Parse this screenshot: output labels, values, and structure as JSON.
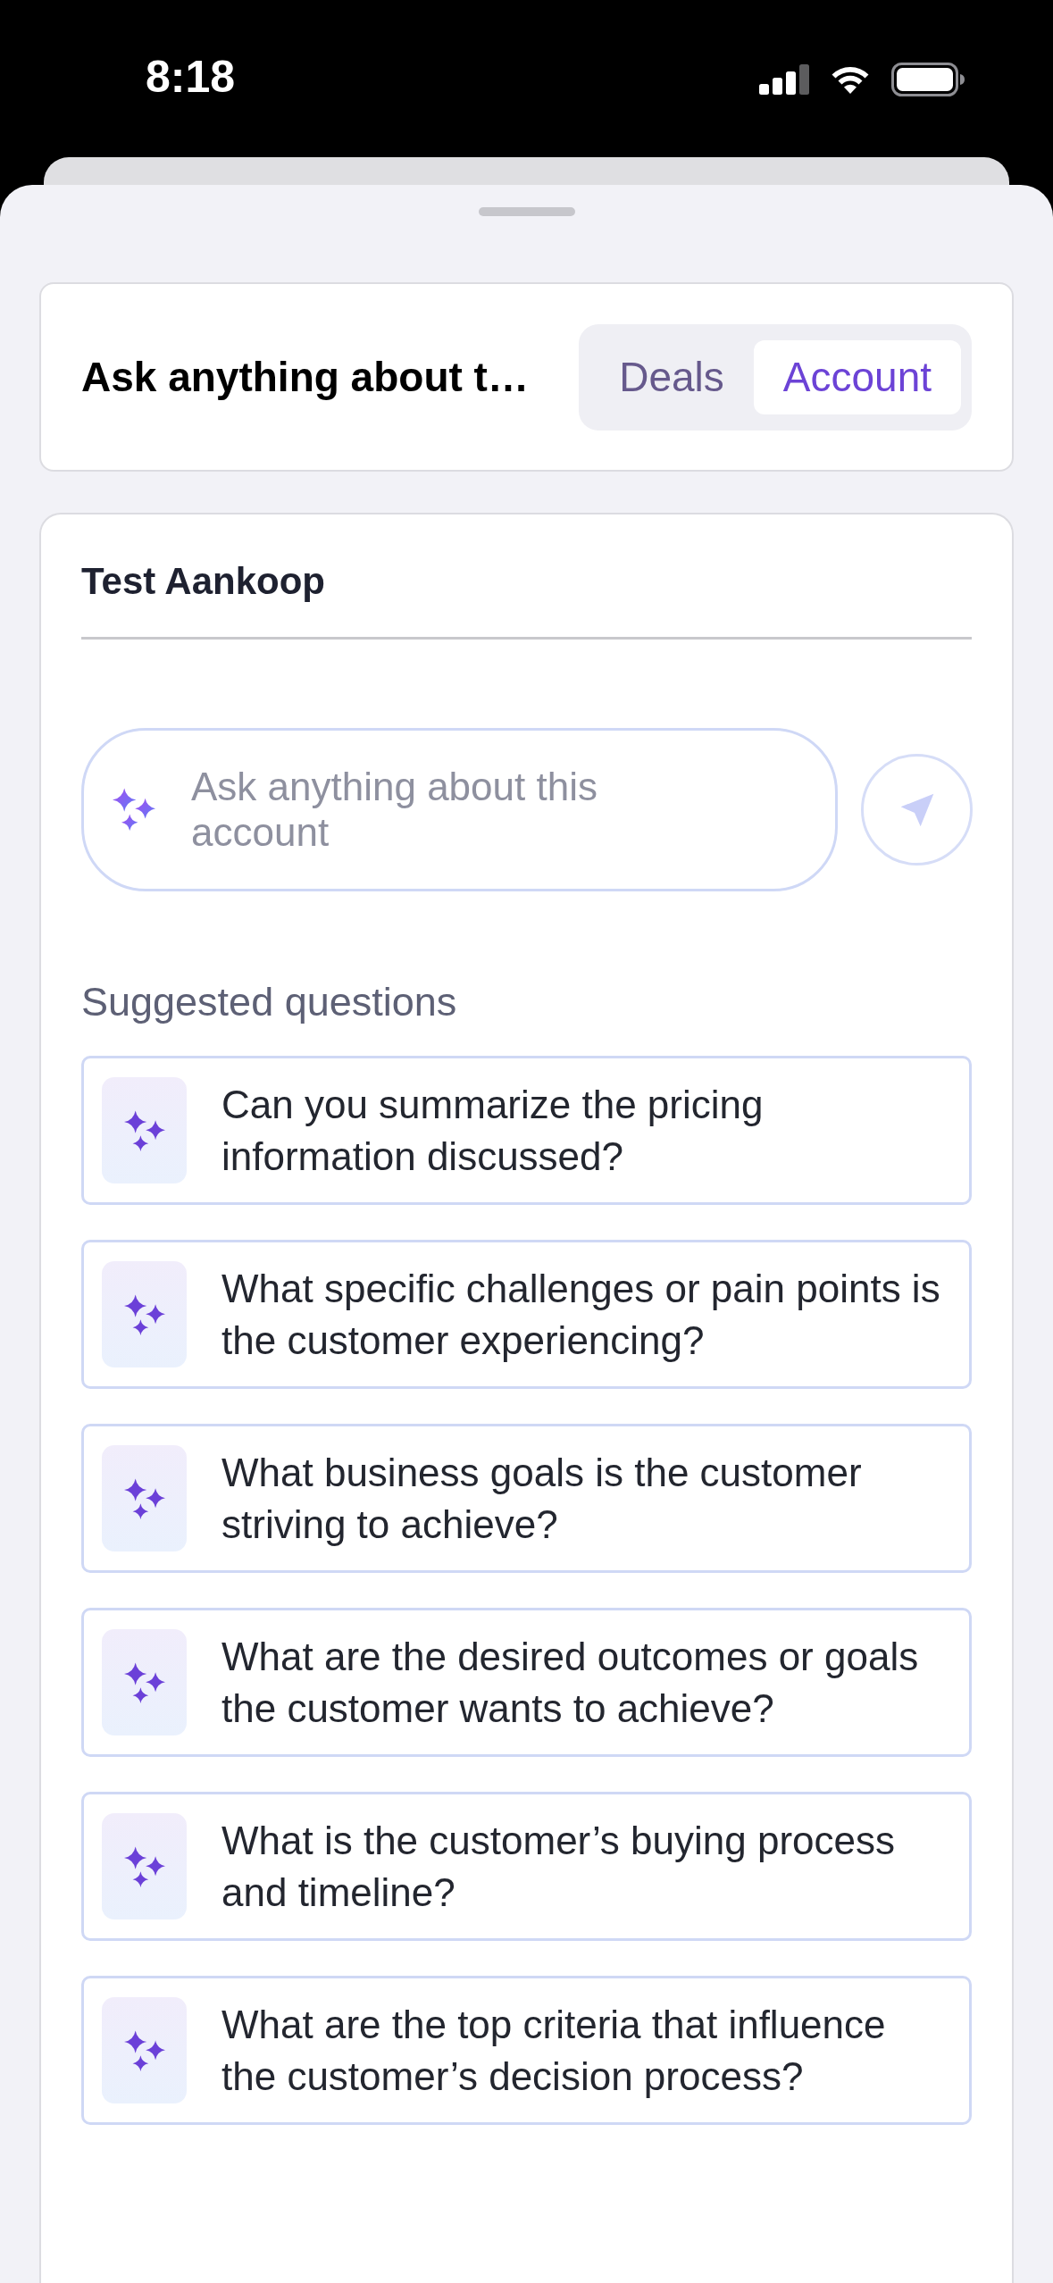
{
  "status_bar": {
    "time": "8:18"
  },
  "header": {
    "title": "Ask anything about t…",
    "tabs": [
      {
        "label": "Deals",
        "selected": false
      },
      {
        "label": "Account",
        "selected": true
      }
    ]
  },
  "account": {
    "name": "Test Aankoop",
    "ask_field": {
      "placeholder": "Ask anything about this account"
    },
    "suggested_title": "Suggested questions",
    "questions": [
      "Can you summarize the pricing information discussed?",
      "What specific challenges or pain points is the customer experiencing?",
      "What business goals is the customer striving to achieve?",
      "What are the desired outcomes or goals the customer wants to achieve?",
      "What is the customer’s buying process and timeline?",
      "What are the top criteria that influence the customer’s decision process?"
    ]
  }
}
